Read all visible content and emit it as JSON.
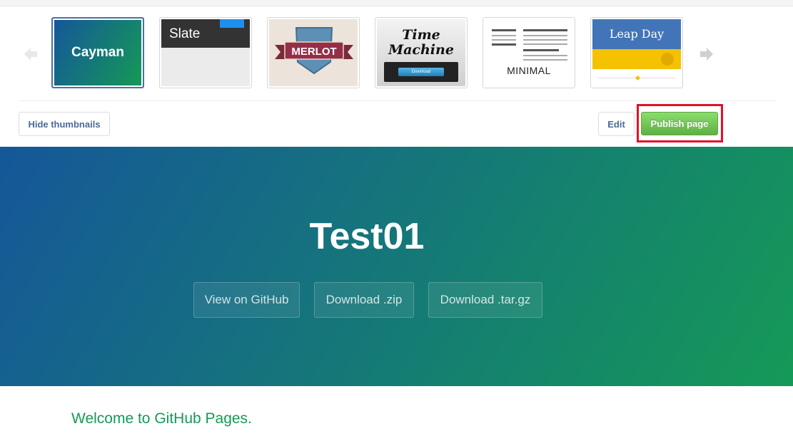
{
  "nav": {
    "prev_icon": "arrow-left-icon",
    "next_icon": "arrow-right-icon"
  },
  "themes": [
    {
      "name": "Cayman",
      "selected": true
    },
    {
      "name": "Slate"
    },
    {
      "name": "MERLOT"
    },
    {
      "name": "Time",
      "name2": "Machine",
      "button_label": "Download"
    },
    {
      "name": "MINIMAL"
    },
    {
      "name": "Leap Day",
      "icon": "github-octocat-icon"
    }
  ],
  "toolbar": {
    "hide_thumbnails": "Hide thumbnails",
    "edit": "Edit",
    "publish": "Publish page"
  },
  "hero": {
    "title": "Test01",
    "buttons": [
      "View on GitHub",
      "Download .zip",
      "Download .tar.gz"
    ]
  },
  "content": {
    "heading": "Welcome to GitHub Pages."
  },
  "colors": {
    "accent_green": "#159957",
    "accent_blue": "#155799",
    "highlight_red": "#e3102b",
    "publish_green": "#6cc644"
  }
}
